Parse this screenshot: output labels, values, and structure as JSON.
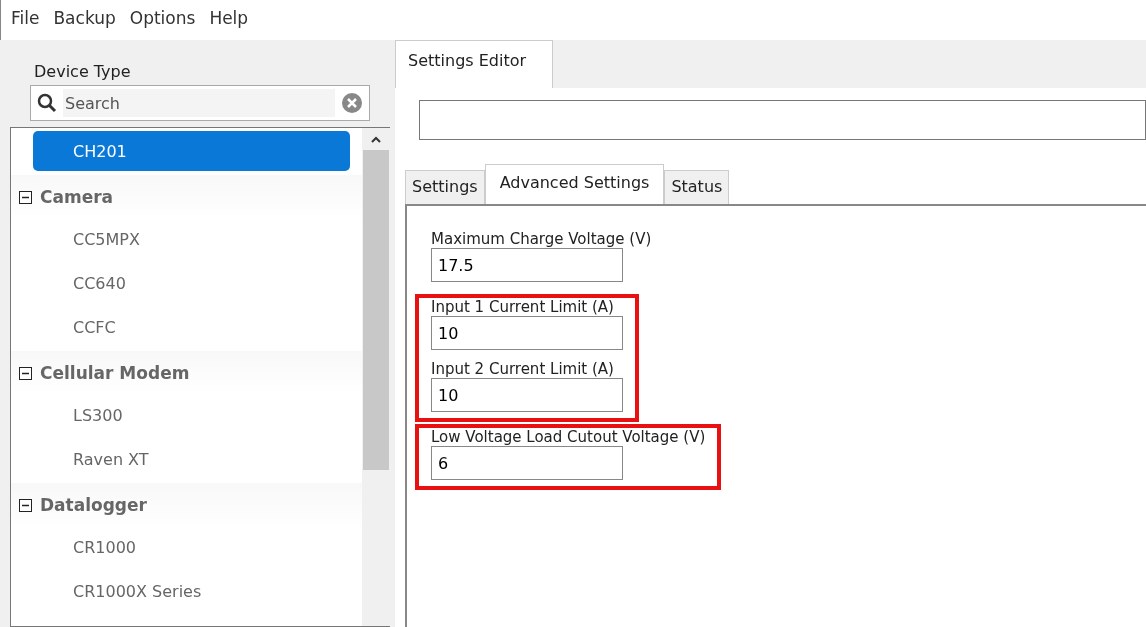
{
  "menu": [
    "File",
    "Backup",
    "Options",
    "Help"
  ],
  "sidebar": {
    "title": "Device Type",
    "search": {
      "placeholder": "Search"
    },
    "tree": [
      {
        "label": "CH201",
        "selected": true
      },
      {
        "label": "Camera",
        "expanded": true,
        "children": [
          {
            "label": "CC5MPX",
            "selected": false
          },
          {
            "label": "CC640",
            "selected": false
          },
          {
            "label": "CCFC",
            "selected": false
          }
        ]
      },
      {
        "label": "Cellular Modem",
        "expanded": true,
        "children": [
          {
            "label": "LS300",
            "selected": false
          },
          {
            "label": "Raven XT",
            "selected": false
          }
        ]
      },
      {
        "label": "Datalogger",
        "expanded": true,
        "children": [
          {
            "label": "CR1000",
            "selected": false
          },
          {
            "label": "CR1000X Series",
            "selected": false
          }
        ]
      }
    ]
  },
  "editor_tab": {
    "label": "Settings Editor",
    "selected": true
  },
  "tabs": [
    {
      "label": "Settings",
      "selected": false
    },
    {
      "label": "Advanced Settings",
      "selected": true
    },
    {
      "label": "Status",
      "selected": false
    }
  ],
  "groups": [
    {
      "highlighted": false,
      "fields": [
        {
          "label": "Maximum Charge Voltage (V)",
          "value": "17.5"
        }
      ]
    },
    {
      "highlighted": true,
      "fields": [
        {
          "label": "Input 1 Current Limit (A)",
          "value": "10"
        },
        {
          "label": "Input 2 Current Limit (A)",
          "value": "10"
        }
      ]
    },
    {
      "highlighted": true,
      "fields": [
        {
          "label": "Low Voltage Load Cutout Voltage (V)",
          "value": "6"
        }
      ]
    }
  ]
}
